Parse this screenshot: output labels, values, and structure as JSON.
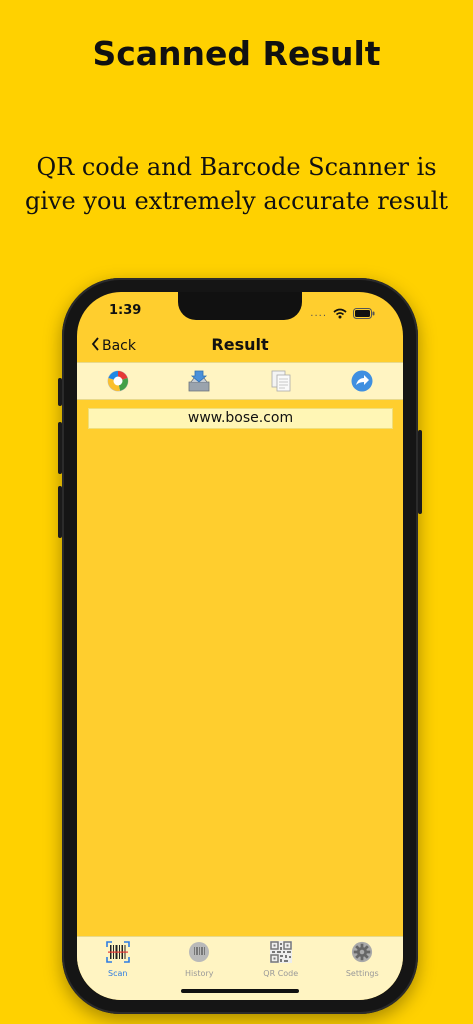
{
  "promo": {
    "headline": "Scanned Result",
    "subline": "QR code and Barcode Scanner is give you extremely accurate result"
  },
  "status": {
    "time": "1:39",
    "dots": "....",
    "wifi_icon": "wifi-icon",
    "battery_icon": "battery-icon"
  },
  "nav": {
    "back_label": "Back",
    "title": "Result"
  },
  "toolbar": {
    "items": [
      {
        "icon": "google-search-icon"
      },
      {
        "icon": "save-download-icon"
      },
      {
        "icon": "copy-icon"
      },
      {
        "icon": "share-icon"
      }
    ]
  },
  "result": {
    "text": "www.bose.com"
  },
  "tabbar": {
    "items": [
      {
        "label": "Scan",
        "icon": "barcode-scan-icon",
        "active": true
      },
      {
        "label": "History",
        "icon": "history-icon",
        "active": false
      },
      {
        "label": "QR Code",
        "icon": "qr-code-icon",
        "active": false
      },
      {
        "label": "Settings",
        "icon": "gear-icon",
        "active": false
      }
    ]
  },
  "colors": {
    "background": "#FFD100",
    "screen": "#FFCE2E",
    "active_tab": "#2f7de1"
  }
}
